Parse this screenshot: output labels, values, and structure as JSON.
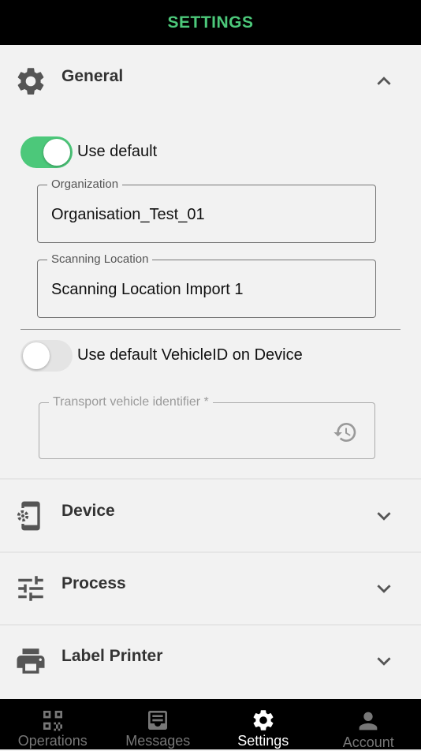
{
  "header": {
    "title": "SETTINGS"
  },
  "general": {
    "label": "General",
    "use_default_label": "Use default",
    "organization": {
      "legend": "Organization",
      "value": "Organisation_Test_01"
    },
    "scanning_location": {
      "legend": "Scanning Location",
      "value": "Scanning Location Import 1"
    },
    "vehicle_toggle_label": "Use default VehicleID on Device",
    "transport_vehicle": {
      "legend": "Transport vehicle identifier *",
      "value": ""
    }
  },
  "sections": {
    "device": "Device",
    "process": "Process",
    "label_printer": "Label Printer"
  },
  "tabs": {
    "operations": "Operations",
    "messages": "Messages",
    "settings": "Settings",
    "account": "Account"
  },
  "colors": {
    "accent": "#4cc87a",
    "bar": "#000000",
    "background": "#f2f2f2"
  }
}
